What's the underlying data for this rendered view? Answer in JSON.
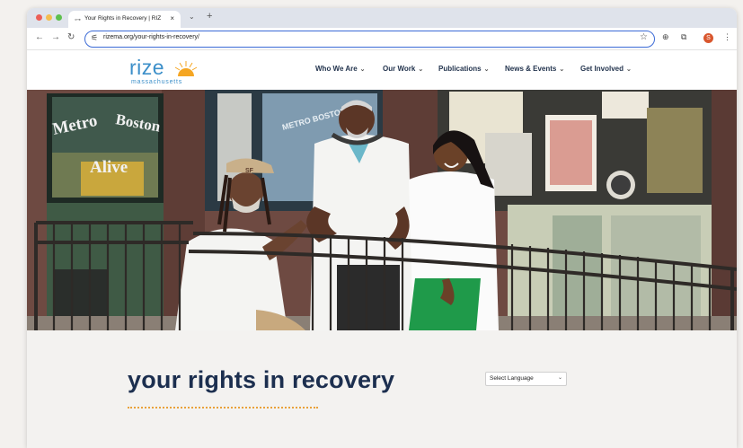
{
  "browser": {
    "tab_title": "Your Rights in Recovery | RIZ",
    "tab_close": "×",
    "tab_menu": "⌄",
    "new_tab": "+",
    "url": "rizema.org/your-rights-in-recovery/",
    "profile_initial": "S"
  },
  "site": {
    "logo_word": "rize",
    "logo_sub": "massachusetts",
    "nav": [
      {
        "label": "Who We Are"
      },
      {
        "label": "Our Work"
      },
      {
        "label": "Publications"
      },
      {
        "label": "News & Events"
      },
      {
        "label": "Get Involved"
      }
    ]
  },
  "hero": {
    "window_text_1": "Metro",
    "window_text_2": "Boston",
    "window_text_3": "Alive",
    "window_text_4": "METRO BOSTON",
    "cap_text": "SF"
  },
  "page": {
    "title": "your rights in recovery",
    "language_select": "Select Language"
  },
  "colors": {
    "brand_blue": "#3c8fc9",
    "brand_navy": "#1c2f4f",
    "accent_orange": "#e9a23b",
    "omnibox_border": "#3b6ad6"
  }
}
